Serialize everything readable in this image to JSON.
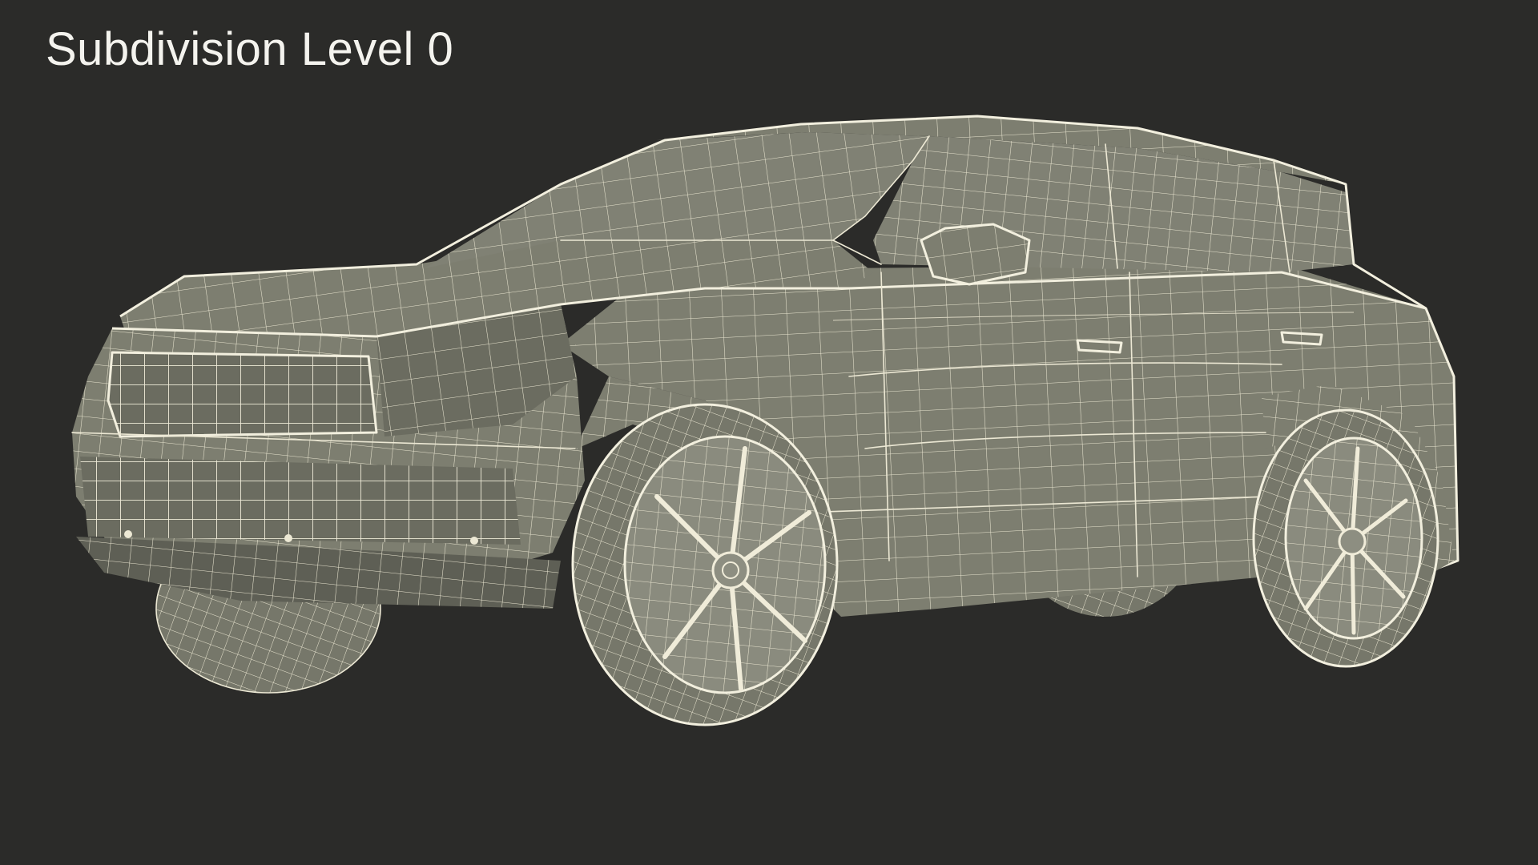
{
  "render": {
    "label": "Subdivision Level 0",
    "subject": "suv-wireframe-3d-model",
    "colors": {
      "background": "#2b2b29",
      "mesh_surface": "#7d7e70",
      "wireframe": "#ece8d4",
      "label_text": "#f4f3ee"
    }
  }
}
